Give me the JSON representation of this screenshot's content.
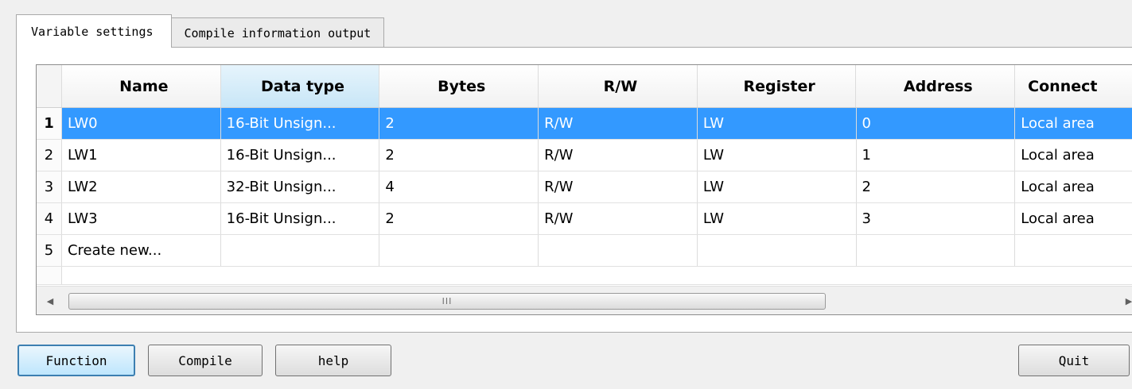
{
  "tabs": [
    {
      "label": "Variable settings"
    },
    {
      "label": "Compile information output"
    }
  ],
  "grid": {
    "columns": [
      "Name",
      "Data type",
      "Bytes",
      "R/W",
      "Register",
      "Address",
      "Connect"
    ],
    "rows": [
      {
        "index": "1",
        "name": "LW0",
        "type": "16-Bit Unsign...",
        "bytes": "2",
        "rw": "R/W",
        "register": "LW",
        "address": "0",
        "connect": "Local area"
      },
      {
        "index": "2",
        "name": "LW1",
        "type": "16-Bit Unsign...",
        "bytes": "2",
        "rw": "R/W",
        "register": "LW",
        "address": "1",
        "connect": "Local area"
      },
      {
        "index": "3",
        "name": "LW2",
        "type": "32-Bit Unsign...",
        "bytes": "4",
        "rw": "R/W",
        "register": "LW",
        "address": "2",
        "connect": "Local area"
      },
      {
        "index": "4",
        "name": "LW3",
        "type": "16-Bit Unsign...",
        "bytes": "2",
        "rw": "R/W",
        "register": "LW",
        "address": "3",
        "connect": "Local area"
      }
    ],
    "new_row": {
      "index": "5",
      "label": "Create new..."
    },
    "selected_row": 1,
    "sorted_column": "Data type"
  },
  "scrollbar": {
    "left_arrow_icon": "triangle-left-icon",
    "right_arrow_icon": "triangle-right-icon",
    "grip": "III"
  },
  "buttons": {
    "function": "Function",
    "compile": "Compile",
    "help": "help",
    "quit": "Quit"
  },
  "colors": {
    "selection": "#3399ff",
    "sorted_header": "#c8e6f7",
    "default_button_border": "#3c7fb1"
  }
}
